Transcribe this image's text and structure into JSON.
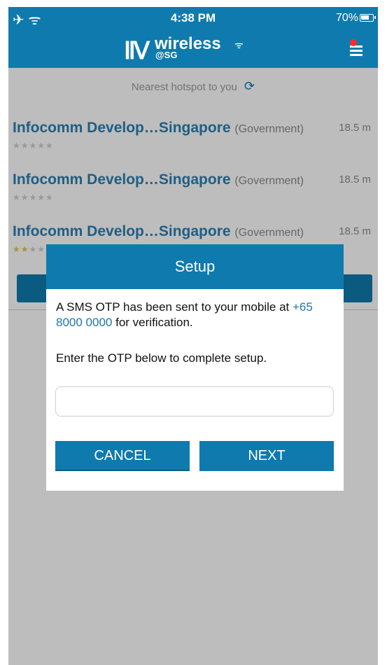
{
  "status_bar": {
    "left_icons": "✈ ᯤ",
    "time": "4:38 PM",
    "battery": "70%"
  },
  "header": {
    "logo_word": "wireless",
    "logo_sub": "@SG",
    "accent_color": "#0f7aad",
    "notification_dot_color": "#ff2a2a"
  },
  "background": {
    "nearest_label": "Nearest hotspot to you",
    "hotspots": [
      {
        "name": "Infocomm Develop…Singapore",
        "category": "(Government)",
        "distance": "18.5 m",
        "rating": 0
      },
      {
        "name": "Infocomm Develop…Singapore",
        "category": "(Government)",
        "distance": "18.5 m",
        "rating": 0
      },
      {
        "name": "Infocomm Develop…Singapore",
        "category": "(Government)",
        "distance": "18.5 m",
        "rating": 2
      }
    ]
  },
  "dialog": {
    "title": "Setup",
    "message_prefix": "A SMS OTP has been sent to your mobile at",
    "phone": "+65 8000 0000",
    "message_suffix": "for verification.",
    "instruction": "Enter the OTP below to complete setup.",
    "otp_value": "",
    "otp_placeholder": "",
    "cancel_label": "CANCEL",
    "next_label": "NEXT"
  }
}
